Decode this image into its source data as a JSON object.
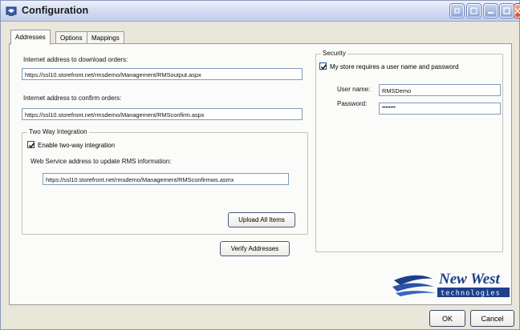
{
  "window": {
    "title": "Configuration"
  },
  "tabs": [
    {
      "label": "Addresses",
      "active": true
    },
    {
      "label": "Options",
      "active": false
    },
    {
      "label": "Mappings",
      "active": false
    }
  ],
  "addresses": {
    "download_label": "Internet address to download orders:",
    "download_value": "https://ssl10.storefront.net/rmsdemo/Management/RMSoutput.aspx",
    "confirm_label": "Internet address to confirm orders:",
    "confirm_value": "https://ssl10.storefront.net/rmsdemo/Management/RMSconfirm.aspx",
    "verify_button": "Verify Addresses"
  },
  "two_way": {
    "group_title": "Two Way Integration",
    "enable_label": "Enable two-way integration",
    "enable_checked": true,
    "service_label": "Web Service address to update RMS information:",
    "service_value": "https://ssl10.storefront.net/rmsdemo/Management/RMSconfirmws.asmx",
    "upload_button": "Upload All Items"
  },
  "security": {
    "group_title": "Security",
    "requires_label": "My store requires a user name and password",
    "requires_checked": true,
    "username_label": "User name:",
    "username_value": "RMSDemo",
    "password_label": "Password:",
    "password_value": "••••••••"
  },
  "logo": {
    "text_main": "New West",
    "text_sub": "technologies"
  },
  "footer": {
    "ok_label": "OK",
    "cancel_label": "Cancel"
  },
  "colors": {
    "window_bg": "#e9e6da",
    "titlebar": "#c1cdea",
    "logo_blue": "#1e3f8c",
    "close_red": "#d4472c"
  }
}
